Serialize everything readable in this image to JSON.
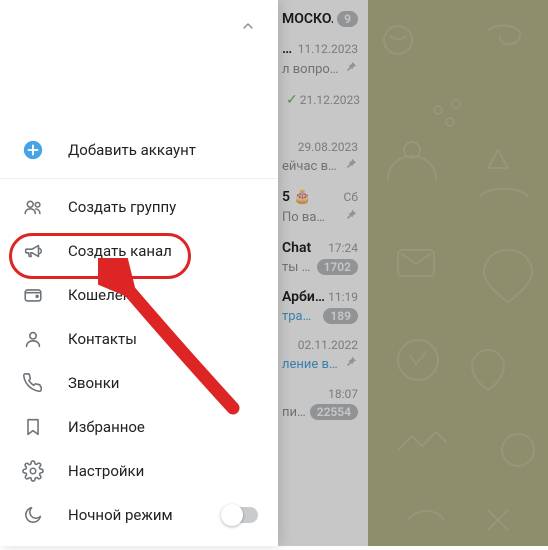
{
  "menu": {
    "add_account": "Добавить аккаунт",
    "new_group": "Создать группу",
    "new_channel": "Создать канал",
    "wallet": "Кошелёк",
    "contacts": "Контакты",
    "calls": "Звонки",
    "saved": "Избранное",
    "settings": "Настройки",
    "night_mode": "Ночной режим"
  },
  "chats": [
    {
      "name": "МОСКО…",
      "date": "",
      "preview": "",
      "badge": "9"
    },
    {
      "name": "…",
      "date": "11.12.2023",
      "preview": "л вопро…",
      "pin": true
    },
    {
      "name": "",
      "date": "21.12.2023",
      "preview": "",
      "check": true
    },
    {
      "name": "",
      "date": "29.08.2023",
      "preview": "ейчас в…",
      "pin": true
    },
    {
      "name": "5 🎂",
      "date": "Сб",
      "preview": "По ва…",
      "pin": true
    },
    {
      "name": "Chat",
      "date": "17:24",
      "preview": "ты т…",
      "badge": "1702"
    },
    {
      "name": "Арби…",
      "date": "11:19",
      "preview": "траж …",
      "badge": "189"
    },
    {
      "name": "",
      "date": "02.11.2022",
      "preview": "ление в …",
      "pin": true
    },
    {
      "name": "",
      "date": "18:07",
      "preview": "пис…",
      "badge": "22554"
    }
  ]
}
